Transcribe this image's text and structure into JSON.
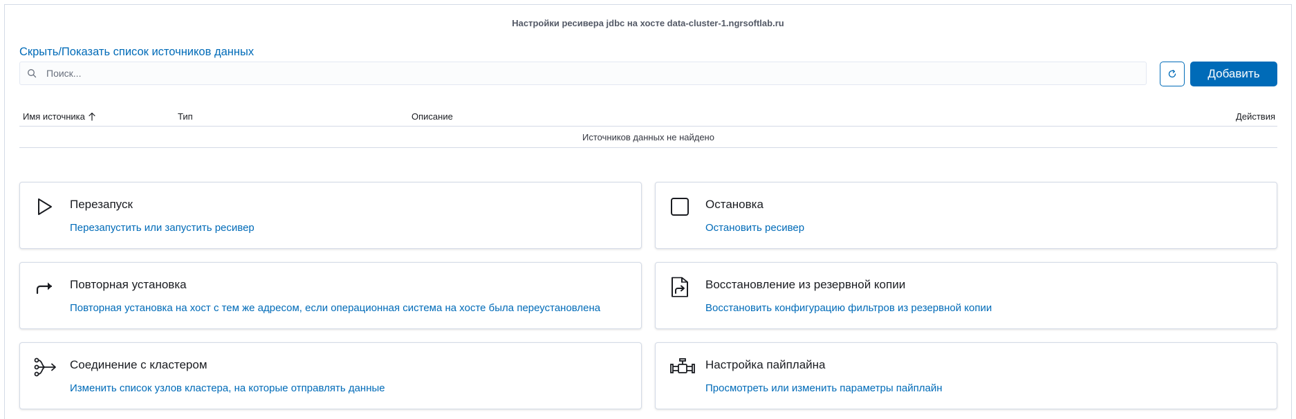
{
  "header": {
    "title": "Настройки ресивера jdbc на хосте data-cluster-1.ngrsoftlab.ru"
  },
  "toggle_link": "Скрыть/Показать список источников данных",
  "search": {
    "placeholder": "Поиск...",
    "value": ""
  },
  "buttons": {
    "refresh_icon": "refresh-icon",
    "add_label": "Добавить"
  },
  "table": {
    "columns": [
      "Имя источника",
      "Тип",
      "Описание",
      "Действия"
    ],
    "sorted_column": "Имя источника",
    "sort_direction": "ascending",
    "empty_message": "Источников данных не найдено"
  },
  "cards": [
    {
      "icon": "play-icon",
      "title": "Перезапуск",
      "description": "Перезапустить или запустить ресивер"
    },
    {
      "icon": "stop-icon",
      "title": "Остановка",
      "description": "Остановить ресивер"
    },
    {
      "icon": "redo-arrow-icon",
      "title": "Повторная установка",
      "description": "Повторная установка на хост с тем же адресом, если операционная система на хосте была переустановлена"
    },
    {
      "icon": "file-import-icon",
      "title": "Восстановление из резервной копии",
      "description": "Восстановить конфигурацию фильтров из резервной копии"
    },
    {
      "icon": "cluster-connection-icon",
      "title": "Соединение с кластером",
      "description": "Изменить список узлов кластера, на которые отправлять данные"
    },
    {
      "icon": "pipeline-icon",
      "title": "Настройка пайплайна",
      "description": "Просмотреть или изменить параметры пайплайн"
    }
  ],
  "colors": {
    "accent": "#006bb8",
    "border": "#d3dae6",
    "text": "#1a1c21",
    "muted": "#535966"
  }
}
